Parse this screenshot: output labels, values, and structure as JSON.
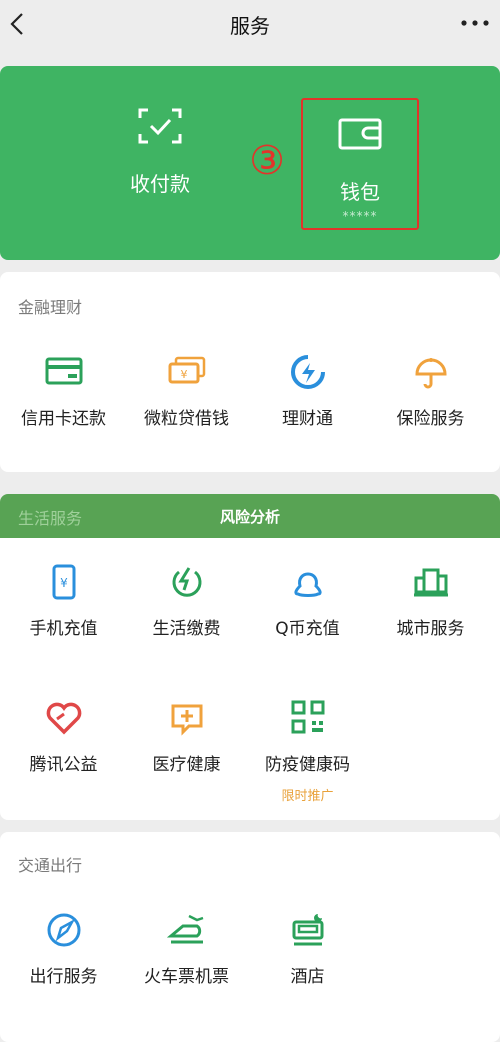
{
  "header": {
    "title": "服务",
    "back_icon": "chevron-left-icon",
    "more_icon": "more-dots-icon"
  },
  "hero": {
    "pay_label": "收付款",
    "wallet_label": "钱包",
    "wallet_balance": "*****",
    "step_marker": "③",
    "highlight_color": "#e3332a",
    "background": "#3fb463"
  },
  "finance": {
    "title": "金融理财",
    "items": [
      {
        "label": "信用卡还款",
        "icon": "credit-card-icon"
      },
      {
        "label": "微粒贷借钱",
        "icon": "loan-icon"
      },
      {
        "label": "理财通",
        "icon": "wealth-icon"
      },
      {
        "label": "保险服务",
        "icon": "insurance-icon"
      }
    ]
  },
  "life": {
    "title": "生活服务",
    "banner_text": "风险分析",
    "items": [
      {
        "label": "手机充值",
        "icon": "phone-topup-icon"
      },
      {
        "label": "生活缴费",
        "icon": "bill-pay-icon"
      },
      {
        "label": "Q币充值",
        "icon": "qq-coin-icon"
      },
      {
        "label": "城市服务",
        "icon": "city-service-icon"
      },
      {
        "label": "腾讯公益",
        "icon": "charity-heart-icon"
      },
      {
        "label": "医疗健康",
        "icon": "medical-icon"
      },
      {
        "label": "防疫健康码",
        "icon": "qr-code-icon",
        "promo": "限时推广"
      }
    ]
  },
  "travel": {
    "title": "交通出行",
    "items": [
      {
        "label": "出行服务",
        "icon": "compass-icon"
      },
      {
        "label": "火车票机票",
        "icon": "train-icon"
      },
      {
        "label": "酒店",
        "icon": "hotel-bed-icon"
      }
    ]
  }
}
